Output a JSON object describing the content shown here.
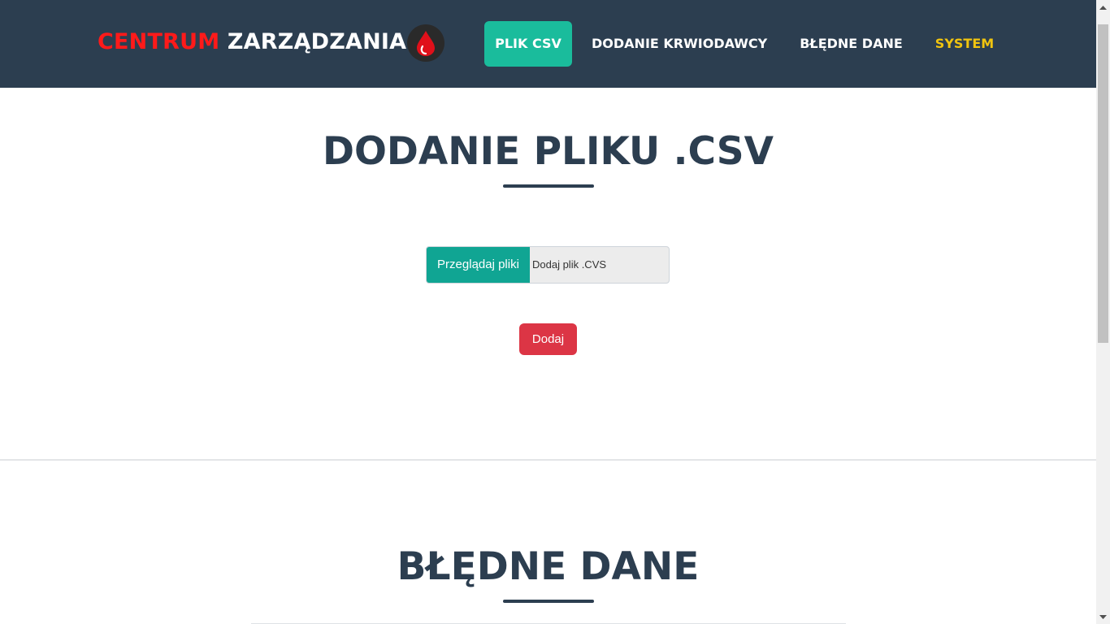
{
  "navbar": {
    "brand_part1": "CENTRUM",
    "brand_part2": "ZARZĄDZANIA",
    "logo_icon": "blood-drop-icon",
    "items": [
      {
        "label": "PLIK CSV",
        "active": true
      },
      {
        "label": "DODANIE KRWIODAWCY",
        "active": false
      },
      {
        "label": "BŁĘDNE DANE",
        "active": false
      },
      {
        "label": "SYSTEM",
        "active": false,
        "color": "#f1c40f"
      }
    ]
  },
  "csv_section": {
    "title": "DODANIE PLIKU .CSV",
    "browse_label": "Przeglądaj pliki",
    "file_label": "Dodaj plik .CVS",
    "submit_label": "Dodaj"
  },
  "errors_section": {
    "title": "BŁĘDNE DANE"
  },
  "colors": {
    "navbar_bg": "#2c3e50",
    "brand_red": "#ff1a1a",
    "accent_teal": "#1abc9c",
    "browse_teal": "#10a593",
    "submit_red": "#dc3545",
    "system_yellow": "#f1c40f"
  }
}
